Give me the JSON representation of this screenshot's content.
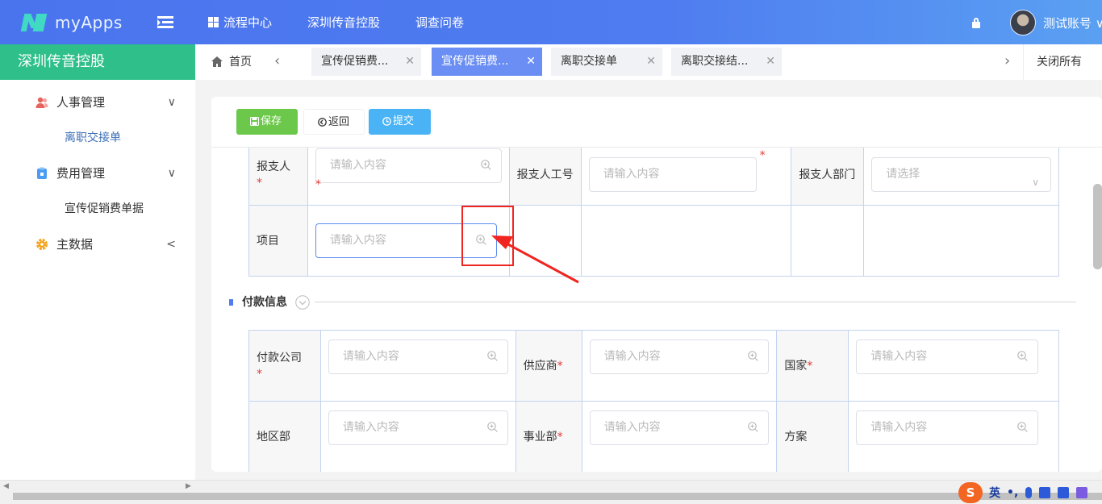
{
  "header": {
    "app_name": "myApps",
    "nav": [
      {
        "label": "流程中心"
      },
      {
        "label": "深圳传音控股"
      },
      {
        "label": "调查问卷"
      }
    ],
    "account": "测试账号 ∨"
  },
  "sidebar": {
    "title": "深圳传音控股",
    "groups": [
      {
        "label": "人事管理",
        "children": [
          "离职交接单"
        ]
      },
      {
        "label": "费用管理",
        "children": [
          "宣传促销费单据"
        ]
      },
      {
        "label": "主数据"
      }
    ]
  },
  "tabs": {
    "home": "首页",
    "items": [
      {
        "label": "宣传促销费...",
        "active": false
      },
      {
        "label": "宣传促销费...",
        "active": true
      },
      {
        "label": "离职交接单",
        "active": false
      },
      {
        "label": "离职交接结...",
        "active": false
      }
    ],
    "close_all": "关闭所有"
  },
  "toolbar": {
    "save": "保存",
    "back": "返回",
    "submit": "提交"
  },
  "form_top": {
    "applicant_label": "报支人",
    "applicant_id_label": "报支人工号",
    "applicant_dept_label": "报支人部门",
    "project_label": "项目",
    "placeholder": "请输入内容",
    "select_placeholder": "请选择",
    "required_mark": "*"
  },
  "payment": {
    "section_title": "付款信息",
    "company_label": "付款公司",
    "supplier_label": "供应商",
    "country_label": "国家",
    "region_label": "地区部",
    "business_label": "事业部",
    "plan_label": "方案",
    "placeholder": "请输入内容"
  },
  "ime": {
    "logo": "S",
    "lang": "英",
    "punct": "•,"
  },
  "colors": {
    "header": "#4f7cf0",
    "sidebar_title": "#2ebf8a",
    "active_tab": "#6a8ef3",
    "save_button": "#6bc84a",
    "submit_button": "#4ab3f5",
    "annotation": "#f0251f"
  }
}
